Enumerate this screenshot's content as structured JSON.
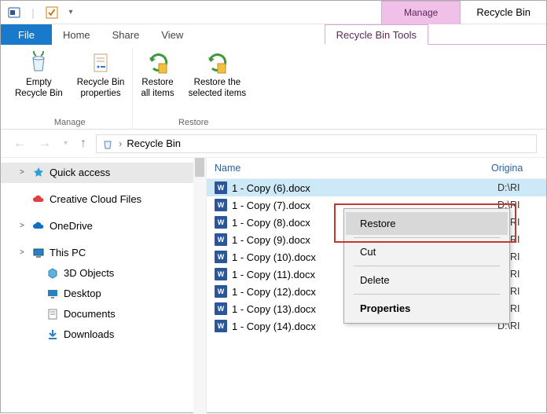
{
  "window": {
    "title": "Recycle Bin",
    "contextual_header": "Manage"
  },
  "qat": {
    "dropdown": "▾"
  },
  "tabs": {
    "file": "File",
    "home": "Home",
    "share": "Share",
    "view": "View",
    "contextual": "Recycle Bin Tools"
  },
  "ribbon": {
    "groups": [
      {
        "label": "Manage",
        "buttons": [
          {
            "key": "empty",
            "line1": "Empty",
            "line2": "Recycle Bin"
          },
          {
            "key": "props",
            "line1": "Recycle Bin",
            "line2": "properties"
          }
        ]
      },
      {
        "label": "Restore",
        "buttons": [
          {
            "key": "restore-all",
            "line1": "Restore",
            "line2": "all items"
          },
          {
            "key": "restore-sel",
            "line1": "Restore the",
            "line2": "selected items"
          }
        ]
      }
    ]
  },
  "breadcrumb": {
    "location": "Recycle Bin"
  },
  "sidebar": {
    "items": [
      {
        "label": "Quick access",
        "level": 1,
        "exp": ">",
        "icon": "star",
        "selected": true
      },
      {
        "label": "Creative Cloud Files",
        "level": 1,
        "exp": "",
        "icon": "cloud-cc"
      },
      {
        "label": "OneDrive",
        "level": 1,
        "exp": ">",
        "icon": "cloud-od"
      },
      {
        "label": "This PC",
        "level": 1,
        "exp": ">",
        "icon": "pc"
      },
      {
        "label": "3D Objects",
        "level": 2,
        "exp": "",
        "icon": "cube"
      },
      {
        "label": "Desktop",
        "level": 2,
        "exp": "",
        "icon": "desktop"
      },
      {
        "label": "Documents",
        "level": 2,
        "exp": "",
        "icon": "doc"
      },
      {
        "label": "Downloads",
        "level": 2,
        "exp": "",
        "icon": "down"
      }
    ]
  },
  "filelist": {
    "columns": {
      "name": "Name",
      "original": "Origina"
    },
    "rows": [
      {
        "name": "1 - Copy (6).docx",
        "orig": "D:\\RI",
        "selected": true
      },
      {
        "name": "1 - Copy (7).docx",
        "orig": "D:\\RI"
      },
      {
        "name": "1 - Copy (8).docx",
        "orig": "D:\\RI"
      },
      {
        "name": "1 - Copy (9).docx",
        "orig": "D:\\RI"
      },
      {
        "name": "1 - Copy (10).docx",
        "orig": "D:\\RI"
      },
      {
        "name": "1 - Copy (11).docx",
        "orig": "D:\\RI"
      },
      {
        "name": "1 - Copy (12).docx",
        "orig": "D:\\RI"
      },
      {
        "name": "1 - Copy (13).docx",
        "orig": "D:\\RI"
      },
      {
        "name": "1 - Copy (14).docx",
        "orig": "D:\\RI"
      }
    ]
  },
  "contextmenu": {
    "restore": "Restore",
    "cut": "Cut",
    "delete": "Delete",
    "properties": "Properties"
  }
}
